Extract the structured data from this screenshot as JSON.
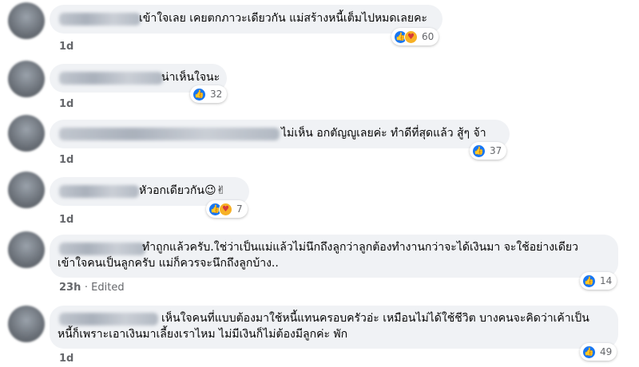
{
  "comments": [
    {
      "text": "เข้าใจเลย เคยตกภาวะเดียวกัน แม่สร้างหนี้เต็มไปหมดเลยคะ",
      "time": "1d",
      "reactions": [
        "like-icon",
        "care-icon"
      ],
      "count": "60"
    },
    {
      "text": "น่าเห็นใจนะ",
      "time": "1d",
      "reactions": [
        "like-icon"
      ],
      "count": "32"
    },
    {
      "text": "ไม่เห็น อกตัญญูเลยค่ะ ทำดีที่สุดแล้ว สู้ๆ จ้า",
      "time": "1d",
      "reactions": [
        "like-icon"
      ],
      "count": "37"
    },
    {
      "text": "หัวอกเดียวกัน",
      "emoji": "😉✌",
      "time": "1d",
      "reactions": [
        "like-icon",
        "care-icon"
      ],
      "count": "7"
    },
    {
      "lines": [
        "ทำถูกแล้วครับ.ใช่ว่าเป็นแม่แล้วไม่นึกถึงลูกว่าลูกต้องทำงานกว่าจะได้เงินมา จะใช้อย่างเดียว",
        "เข้าใจคนเป็นลูกครับ แม่ก็ควรจะนึกถึงลูกบ้าง.."
      ],
      "time": "23h",
      "edited": "· Edited",
      "reactions": [
        "like-icon"
      ],
      "count": "14"
    },
    {
      "lines": [
        "เห็นใจคนที่แบบต้องมาใช้หนี้แทนครอบครัวอ่ะ เหมือนไม่ได้ใช้ชีวิต บางคนจะคิดว่าเค้าเป็น",
        "หนี้ก็เพราะเอาเงินมาเลี้ยงเราไหม ไม่มีเงินก็ไม่ต้องมีลูกค่ะ พัก"
      ],
      "time": "1d",
      "reactions": [
        "like-icon"
      ],
      "count": "49"
    }
  ]
}
